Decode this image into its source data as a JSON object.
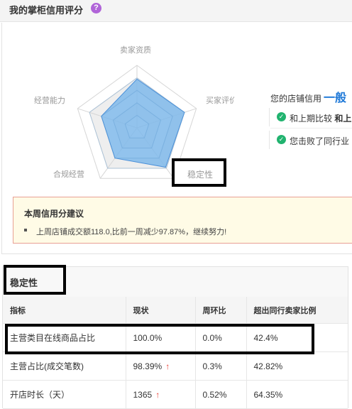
{
  "header": {
    "title": "我的掌柜信用评分",
    "help_glyph": "?"
  },
  "radar": {
    "dimensions": [
      "卖家资质",
      "买家评价",
      "稳定性",
      "合规经营",
      "经营能力"
    ],
    "values": [
      0.78,
      0.8,
      0.78,
      0.6,
      0.6
    ],
    "fill_color": "#7fb8ea",
    "stroke_color": "#4a90d9"
  },
  "credit": {
    "label": "您的店铺信用",
    "level": "一般",
    "compare_prefix": "和上期比较",
    "compare_value": "和上",
    "beat_text": "您击败了同行业"
  },
  "highlight_label": "稳定性",
  "advice": {
    "title": "本周信用分建议",
    "items": [
      "上周店铺成交额118.0,比前一周减少97.87%，继续努力!"
    ]
  },
  "section": {
    "title": "稳定性"
  },
  "table": {
    "headers": [
      "指标",
      "现状",
      "周环比",
      "超出同行卖家比例"
    ],
    "rows": [
      {
        "metric": "主营类目在线商品占比",
        "current": "100.0%",
        "arrow": "",
        "wow": "0.0%",
        "exceed": "42.4%"
      },
      {
        "metric": "主营占比(成交笔数)",
        "current": "98.39%",
        "arrow": "↑",
        "wow": "0.3%",
        "exceed": "42.82%"
      },
      {
        "metric": "开店时长（天）",
        "current": "1365",
        "arrow": "↑",
        "wow": "0.52%",
        "exceed": "64.35%"
      }
    ]
  }
}
